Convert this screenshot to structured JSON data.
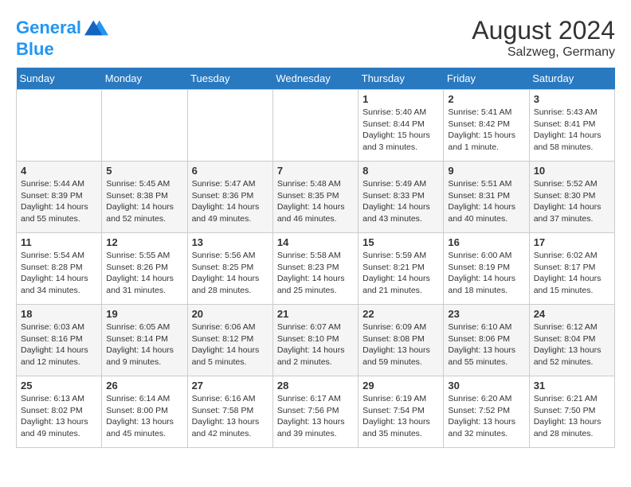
{
  "header": {
    "logo_line1": "General",
    "logo_line2": "Blue",
    "month_year": "August 2024",
    "location": "Salzweg, Germany"
  },
  "weekdays": [
    "Sunday",
    "Monday",
    "Tuesday",
    "Wednesday",
    "Thursday",
    "Friday",
    "Saturday"
  ],
  "weeks": [
    [
      {
        "day": "",
        "info": ""
      },
      {
        "day": "",
        "info": ""
      },
      {
        "day": "",
        "info": ""
      },
      {
        "day": "",
        "info": ""
      },
      {
        "day": "1",
        "info": "Sunrise: 5:40 AM\nSunset: 8:44 PM\nDaylight: 15 hours\nand 3 minutes."
      },
      {
        "day": "2",
        "info": "Sunrise: 5:41 AM\nSunset: 8:42 PM\nDaylight: 15 hours\nand 1 minute."
      },
      {
        "day": "3",
        "info": "Sunrise: 5:43 AM\nSunset: 8:41 PM\nDaylight: 14 hours\nand 58 minutes."
      }
    ],
    [
      {
        "day": "4",
        "info": "Sunrise: 5:44 AM\nSunset: 8:39 PM\nDaylight: 14 hours\nand 55 minutes."
      },
      {
        "day": "5",
        "info": "Sunrise: 5:45 AM\nSunset: 8:38 PM\nDaylight: 14 hours\nand 52 minutes."
      },
      {
        "day": "6",
        "info": "Sunrise: 5:47 AM\nSunset: 8:36 PM\nDaylight: 14 hours\nand 49 minutes."
      },
      {
        "day": "7",
        "info": "Sunrise: 5:48 AM\nSunset: 8:35 PM\nDaylight: 14 hours\nand 46 minutes."
      },
      {
        "day": "8",
        "info": "Sunrise: 5:49 AM\nSunset: 8:33 PM\nDaylight: 14 hours\nand 43 minutes."
      },
      {
        "day": "9",
        "info": "Sunrise: 5:51 AM\nSunset: 8:31 PM\nDaylight: 14 hours\nand 40 minutes."
      },
      {
        "day": "10",
        "info": "Sunrise: 5:52 AM\nSunset: 8:30 PM\nDaylight: 14 hours\nand 37 minutes."
      }
    ],
    [
      {
        "day": "11",
        "info": "Sunrise: 5:54 AM\nSunset: 8:28 PM\nDaylight: 14 hours\nand 34 minutes."
      },
      {
        "day": "12",
        "info": "Sunrise: 5:55 AM\nSunset: 8:26 PM\nDaylight: 14 hours\nand 31 minutes."
      },
      {
        "day": "13",
        "info": "Sunrise: 5:56 AM\nSunset: 8:25 PM\nDaylight: 14 hours\nand 28 minutes."
      },
      {
        "day": "14",
        "info": "Sunrise: 5:58 AM\nSunset: 8:23 PM\nDaylight: 14 hours\nand 25 minutes."
      },
      {
        "day": "15",
        "info": "Sunrise: 5:59 AM\nSunset: 8:21 PM\nDaylight: 14 hours\nand 21 minutes."
      },
      {
        "day": "16",
        "info": "Sunrise: 6:00 AM\nSunset: 8:19 PM\nDaylight: 14 hours\nand 18 minutes."
      },
      {
        "day": "17",
        "info": "Sunrise: 6:02 AM\nSunset: 8:17 PM\nDaylight: 14 hours\nand 15 minutes."
      }
    ],
    [
      {
        "day": "18",
        "info": "Sunrise: 6:03 AM\nSunset: 8:16 PM\nDaylight: 14 hours\nand 12 minutes."
      },
      {
        "day": "19",
        "info": "Sunrise: 6:05 AM\nSunset: 8:14 PM\nDaylight: 14 hours\nand 9 minutes."
      },
      {
        "day": "20",
        "info": "Sunrise: 6:06 AM\nSunset: 8:12 PM\nDaylight: 14 hours\nand 5 minutes."
      },
      {
        "day": "21",
        "info": "Sunrise: 6:07 AM\nSunset: 8:10 PM\nDaylight: 14 hours\nand 2 minutes."
      },
      {
        "day": "22",
        "info": "Sunrise: 6:09 AM\nSunset: 8:08 PM\nDaylight: 13 hours\nand 59 minutes."
      },
      {
        "day": "23",
        "info": "Sunrise: 6:10 AM\nSunset: 8:06 PM\nDaylight: 13 hours\nand 55 minutes."
      },
      {
        "day": "24",
        "info": "Sunrise: 6:12 AM\nSunset: 8:04 PM\nDaylight: 13 hours\nand 52 minutes."
      }
    ],
    [
      {
        "day": "25",
        "info": "Sunrise: 6:13 AM\nSunset: 8:02 PM\nDaylight: 13 hours\nand 49 minutes."
      },
      {
        "day": "26",
        "info": "Sunrise: 6:14 AM\nSunset: 8:00 PM\nDaylight: 13 hours\nand 45 minutes."
      },
      {
        "day": "27",
        "info": "Sunrise: 6:16 AM\nSunset: 7:58 PM\nDaylight: 13 hours\nand 42 minutes."
      },
      {
        "day": "28",
        "info": "Sunrise: 6:17 AM\nSunset: 7:56 PM\nDaylight: 13 hours\nand 39 minutes."
      },
      {
        "day": "29",
        "info": "Sunrise: 6:19 AM\nSunset: 7:54 PM\nDaylight: 13 hours\nand 35 minutes."
      },
      {
        "day": "30",
        "info": "Sunrise: 6:20 AM\nSunset: 7:52 PM\nDaylight: 13 hours\nand 32 minutes."
      },
      {
        "day": "31",
        "info": "Sunrise: 6:21 AM\nSunset: 7:50 PM\nDaylight: 13 hours\nand 28 minutes."
      }
    ]
  ]
}
